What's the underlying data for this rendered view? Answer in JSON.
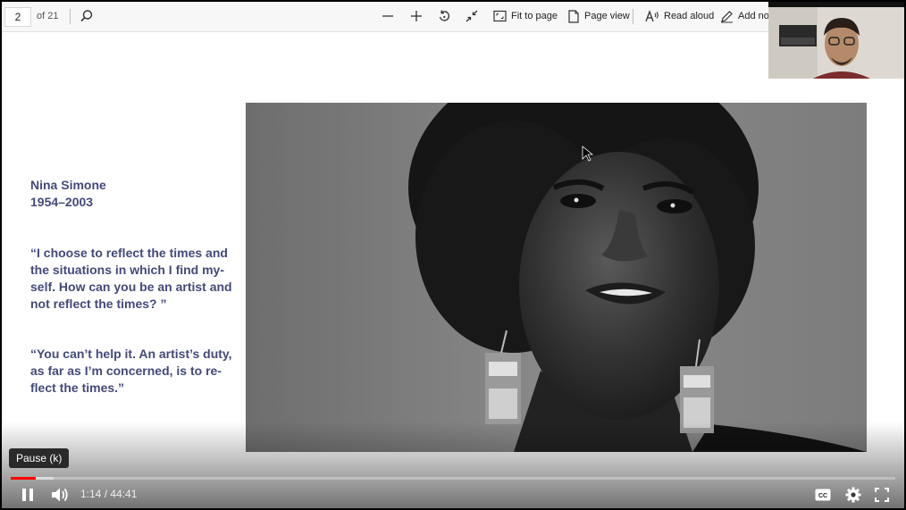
{
  "pdf_toolbar": {
    "page_number": "2",
    "page_total": "of 21",
    "fit_to_page": "Fit to page",
    "page_view": "Page view",
    "read_aloud": "Read aloud",
    "add_notes": "Add not"
  },
  "slide": {
    "name": "Nina Simone",
    "years": "1954–2003",
    "quote1": [
      "“I choose to reflect the times and",
      "the situations in which I find my-",
      "self. How can you be an artist and",
      "not reflect the times? ”"
    ],
    "quote2": [
      "“You can’t help it. An artist’s duty,",
      "as far as I’m concerned, is to re-",
      "flect the times.”"
    ]
  },
  "player": {
    "tooltip": "Pause (k)",
    "current_time": "1:14",
    "duration": "44:41",
    "time_display": "1:14 / 44:41",
    "played_fraction": 0.028,
    "loaded_fraction": 0.048
  },
  "colors": {
    "slide_text": "#444a7a",
    "progress_played": "#ff0000"
  }
}
